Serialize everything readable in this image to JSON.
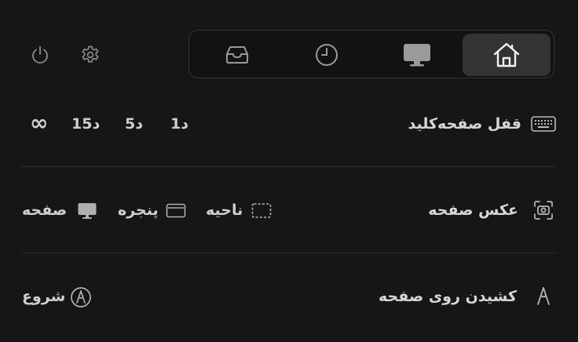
{
  "header": {
    "tabs": [
      {
        "name": "home",
        "icon": "home-icon",
        "active": true
      },
      {
        "name": "display",
        "icon": "monitor-icon",
        "active": false
      },
      {
        "name": "history",
        "icon": "clock-icon",
        "active": false
      },
      {
        "name": "inbox",
        "icon": "inbox-tray-icon",
        "active": false
      }
    ],
    "settings_icon": "gear-icon",
    "power_icon": "power-icon"
  },
  "keyboard_lock": {
    "label": "قفل صفحه‌کلید",
    "icon": "keyboard-icon",
    "durations": [
      "1د",
      "5د",
      "15د"
    ],
    "infinite": "∞"
  },
  "screenshot": {
    "label": "عکس صفحه",
    "icon": "camera-icon",
    "options": {
      "region": "ناحیه",
      "window": "پنجره",
      "screen": "صفحه"
    }
  },
  "draw": {
    "label": "کشیدن روی صفحه",
    "icon": "pen-nib-icon",
    "start": "شروع"
  },
  "colors": {
    "background": "#161616",
    "active_tab": "#333333",
    "text": "#d6d6d6"
  }
}
